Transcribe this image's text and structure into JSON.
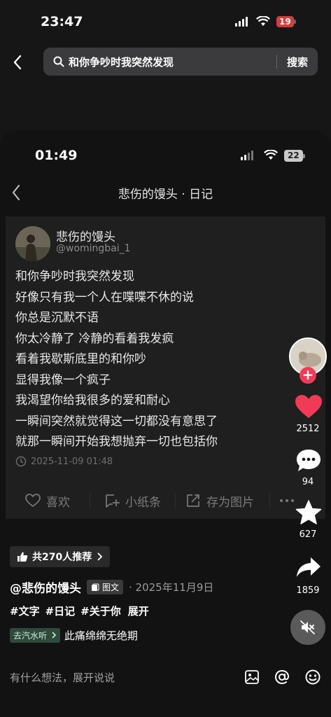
{
  "outer_status": {
    "time": "23:47",
    "battery": "19"
  },
  "search": {
    "query": "和你争吵时我突然发现",
    "button": "搜索"
  },
  "inner_status": {
    "time": "01:49",
    "battery": "22"
  },
  "nav": {
    "title": "悲伤的馒头 · 日记"
  },
  "card": {
    "author_name": "悲伤的馒头",
    "author_handle": "@womingbai_1",
    "lines": [
      "和你争吵时我突然发现",
      "好像只有我一个人在喋喋不休的说",
      "你总是沉默不语",
      "你太冷静了 冷静的看着我发疯",
      "看着我歇斯底里的和你吵",
      "显得我像一个疯子",
      "我渴望你给我很多的爱和耐心",
      "一瞬间突然就觉得这一切都没有意思了",
      "就那一瞬间开始我想抛弃一切也包括你"
    ],
    "post_time": "2025-11-09 01:48",
    "actions": {
      "like": "喜欢",
      "note": "小纸条",
      "save_image": "存为图片"
    }
  },
  "right_rail": {
    "likes": "2512",
    "comments": "94",
    "favorites": "627",
    "shares": "1859"
  },
  "info": {
    "recommend": "共270人推荐",
    "author": "@悲伤的馒头",
    "type_badge": "图文",
    "date": "· 2025年11月9日",
    "tags": [
      "#文字",
      "#日记",
      "#关于你"
    ],
    "expand": "展开",
    "music_badge": "去汽水听",
    "music_title": "此痛绵绵无绝期"
  },
  "comment": {
    "placeholder": "有什么想法，展开说说"
  },
  "colors": {
    "like_red": "#f03b56",
    "accent_pink": "#f03b56"
  }
}
